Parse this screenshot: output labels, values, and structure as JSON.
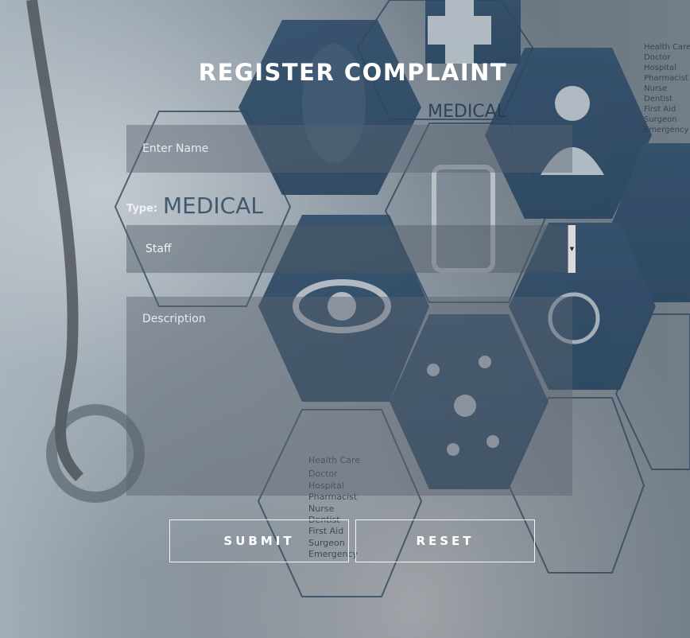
{
  "form": {
    "title": "REGISTER COMPLAINT",
    "name_placeholder": "Enter Name",
    "type_label": "Type:",
    "type_selected": "Staff",
    "description_placeholder": "Description",
    "submit_label": "SUBMIT",
    "reset_label": "RESET"
  },
  "background": {
    "labels": [
      "MEDICAL",
      "MEDICAL"
    ],
    "list": [
      "Health Care",
      "Doctor",
      "Hospital",
      "Pharmacist",
      "Nurse",
      "Dentist",
      "First Aid",
      "Surgeon",
      "Emergency"
    ]
  }
}
